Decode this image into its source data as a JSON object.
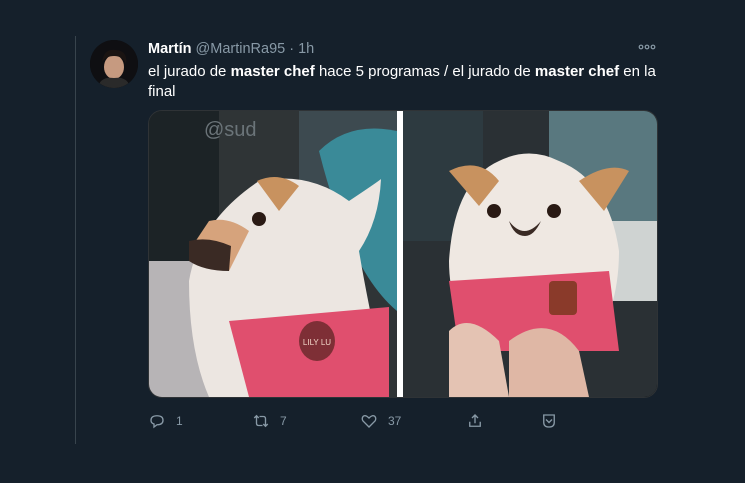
{
  "tweet": {
    "author_name": "Martín",
    "author_handle": "@MartinRa95",
    "separator": "·",
    "time": "1h",
    "more_icon": "more-horizontal-icon",
    "text_parts": [
      {
        "text": "el jurado de ",
        "bold": false
      },
      {
        "text": "master chef",
        "bold": true
      },
      {
        "text": " hace 5 programas / el jurado de ",
        "bold": false
      },
      {
        "text": "master chef",
        "bold": true
      },
      {
        "text": " en la final",
        "bold": false
      }
    ],
    "media": {
      "left_image_tag_text": "LILY LU",
      "left_watermark": "@sud"
    },
    "actions": {
      "replies": "1",
      "retweets": "7",
      "likes": "37"
    }
  },
  "colors": {
    "background": "#15202b",
    "muted": "#8899a6",
    "divider": "#38444d"
  }
}
